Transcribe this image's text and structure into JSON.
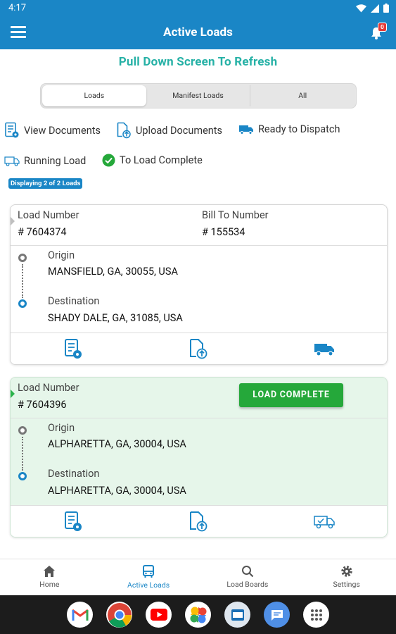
{
  "status_bar": {
    "time": "4:17"
  },
  "app_bar": {
    "title": "Active Loads",
    "notification_count": "0"
  },
  "refresh_hint": "Pull Down Screen To Refresh",
  "tabs": [
    {
      "label": "Loads",
      "active": true
    },
    {
      "label": "Manifest Loads",
      "active": false
    },
    {
      "label": "All",
      "active": false
    }
  ],
  "legend": {
    "view_documents": "View Documents",
    "upload_documents": "Upload Documents",
    "ready_to_dispatch": "Ready to Dispatch",
    "running_load": "Running Load",
    "to_load_complete": "To Load Complete"
  },
  "display_count": "Displaying 2 of 2 Loads",
  "loads": [
    {
      "load_number_label": "Load Number",
      "load_number": "# 7604374",
      "bill_to_label": "Bill To Number",
      "bill_to": "# 155534",
      "origin_label": "Origin",
      "origin": "MANSFIELD, GA, 30055, USA",
      "destination_label": "Destination",
      "destination": "SHADY DALE, GA, 31085, USA",
      "status": "ready-to-dispatch"
    },
    {
      "load_number_label": "Load Number",
      "load_number": "# 7604396",
      "action_label": "LOAD COMPLETE",
      "origin_label": "Origin",
      "origin": "ALPHARETTA, GA, 30004, USA",
      "destination_label": "Destination",
      "destination": "ALPHARETTA, GA, 30004, USA",
      "status": "running-load"
    }
  ],
  "bottom_nav": [
    {
      "label": "Home",
      "icon": "home-icon",
      "active": false
    },
    {
      "label": "Active Loads",
      "icon": "bus-icon",
      "active": true
    },
    {
      "label": "Load Boards",
      "icon": "search-icon",
      "active": false
    },
    {
      "label": "Settings",
      "icon": "gear-icon",
      "active": false
    }
  ],
  "dock_apps": [
    "gmail-icon",
    "chrome-icon",
    "youtube-icon",
    "photos-icon",
    "app-icon",
    "messages-icon",
    "app-drawer-icon"
  ],
  "colors": {
    "primary": "#1a86c6",
    "accent_teal": "#26b1a6",
    "complete_green": "#25a83a",
    "complete_bg": "#e6f6ea",
    "badge_red": "#e53935"
  }
}
